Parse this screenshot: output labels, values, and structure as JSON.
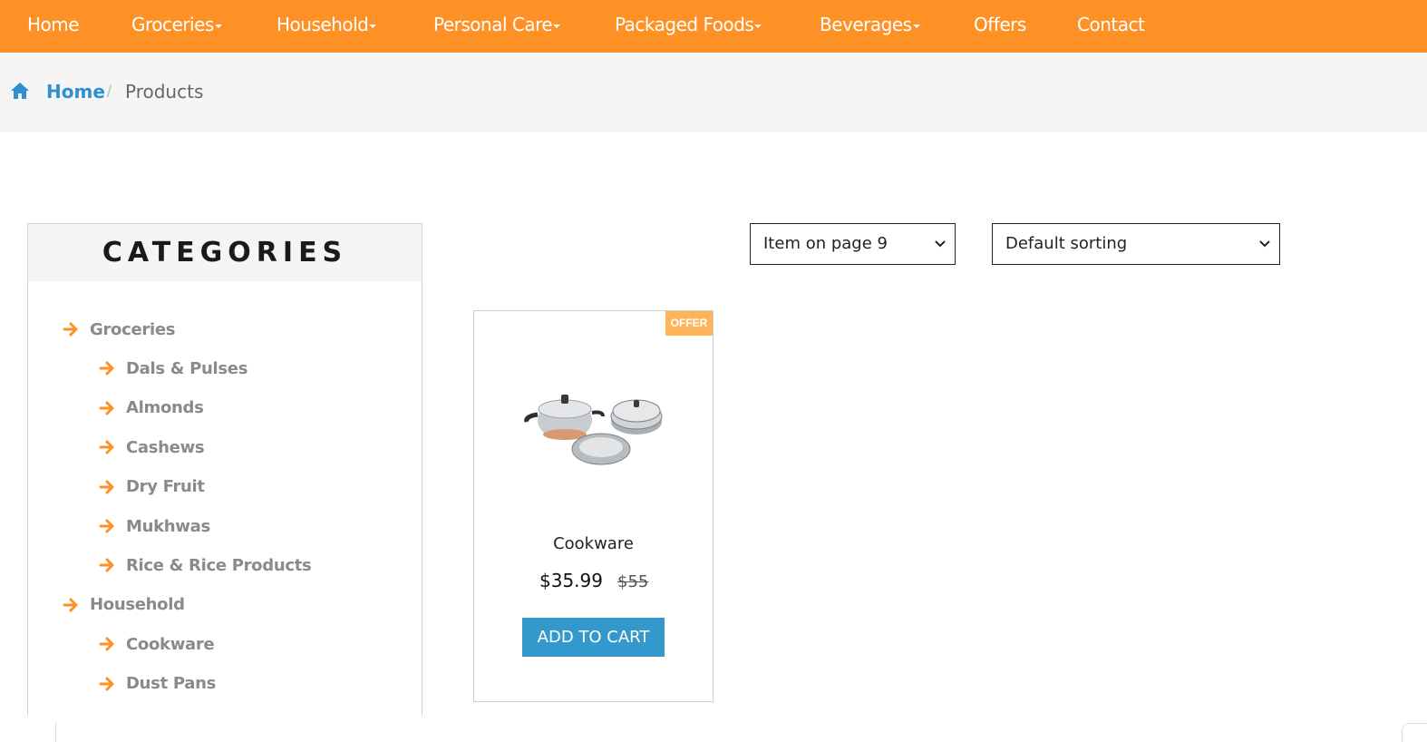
{
  "nav": {
    "items": [
      {
        "label": "Home",
        "dropdown": false
      },
      {
        "label": "Groceries",
        "dropdown": true
      },
      {
        "label": "Household",
        "dropdown": true
      },
      {
        "label": "Personal Care",
        "dropdown": true
      },
      {
        "label": "Packaged Foods",
        "dropdown": true
      },
      {
        "label": "Beverages",
        "dropdown": true
      },
      {
        "label": "Offers",
        "dropdown": false
      },
      {
        "label": "Contact",
        "dropdown": false
      }
    ]
  },
  "breadcrumb": {
    "icon": "home-icon",
    "home": "Home",
    "separator": "/",
    "current": "Products"
  },
  "sidebar": {
    "title": "CATEGORIES",
    "items": [
      {
        "label": "Groceries",
        "level": 1
      },
      {
        "label": "Dals & Pulses",
        "level": 2
      },
      {
        "label": "Almonds",
        "level": 2
      },
      {
        "label": "Cashews",
        "level": 2
      },
      {
        "label": "Dry Fruit",
        "level": 2
      },
      {
        "label": "Mukhwas",
        "level": 2
      },
      {
        "label": "Rice & Rice Products",
        "level": 2
      },
      {
        "label": "Household",
        "level": 1
      },
      {
        "label": "Cookware",
        "level": 2
      },
      {
        "label": "Dust Pans",
        "level": 2
      }
    ]
  },
  "controls": {
    "per_page": "Item on page 9",
    "sorting": "Default sorting"
  },
  "product": {
    "badge": "OFFER",
    "name": "Cookware",
    "price": "$35.99",
    "old_price": "$55",
    "add_to_cart": "ADD TO CART"
  },
  "colors": {
    "accent": "#fe9126",
    "link": "#2f8fcf",
    "button": "#3399cc",
    "badge": "#fdb45b"
  }
}
